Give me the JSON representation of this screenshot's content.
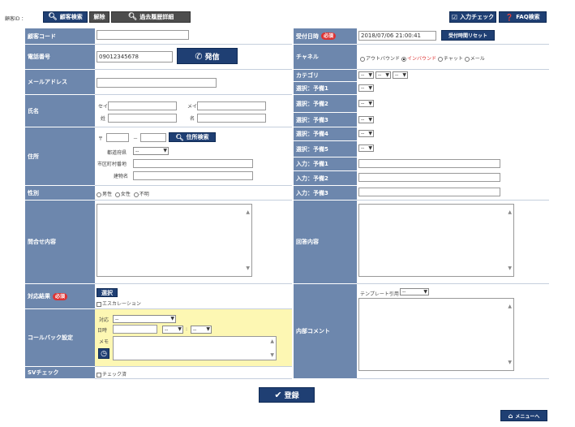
{
  "toolbar": {
    "customer_id_label": "顧客ID ：",
    "customer_search": "顧客検索",
    "clear": "解除",
    "past_history": "過去履歴詳細",
    "input_check": "入力チェック",
    "faq_search": "FAQ検索"
  },
  "left": {
    "customer_code_label": "顧客コード",
    "customer_code_value": "",
    "phone_label": "電話番号",
    "phone_value": "09012345678",
    "call_button": "発信",
    "email_label": "メールアドレス",
    "email_value": "",
    "name_label": "氏名",
    "sei_kana": "セイ",
    "mei_kana": "メイ",
    "sei": "姓",
    "mei": "名",
    "address_label": "住所",
    "postal_mark": "〒",
    "postal_dash": "－",
    "address_search": "住所検索",
    "prefecture_label": "都道府県",
    "prefecture_value": "--",
    "city_label": "市区町村番地",
    "building_label": "建物名",
    "gender_label": "性別",
    "gender_options": [
      "男性",
      "女性",
      "不明"
    ],
    "inquiry_label": "問合せ内容",
    "result_label": "対応結果",
    "required_badge": "必須",
    "select_button": "選択",
    "escalation": "エスカレーション",
    "callback_label": "コールバック設定",
    "callback_handler_label": "対応",
    "callback_handler_value": "--",
    "callback_date_label": "日時",
    "callback_hour": "--",
    "callback_colon": ":",
    "callback_min": "--",
    "callback_memo_label": "メモ",
    "sv_label": "SVチェック",
    "sv_check": "チェック済"
  },
  "right": {
    "received_label": "受付日時",
    "received_value": "2018/07/06 21:00:41",
    "reset_time_button": "受付時間リセット",
    "channel_label": "チャネル",
    "channels": [
      "アウトバウンド",
      "インバウンド",
      "チャット",
      "メール"
    ],
    "channel_selected": 1,
    "category_label": "カテゴリ",
    "category_value": "--",
    "select1_label": "選択：予備1",
    "select2_label": "選択：予備2",
    "select3_label": "選択：予備3",
    "select4_label": "選択：予備4",
    "select5_label": "選択：予備5",
    "input1_label": "入力：予備1",
    "input2_label": "入力：予備2",
    "input3_label": "入力：予備3",
    "select_placeholder": "--",
    "answer_label": "回答内容",
    "comment_label": "内部コメント",
    "template_label": "テンプレート引用",
    "template_value": "--"
  },
  "footer": {
    "register_button": "登録",
    "menu_button": "メニューへ"
  },
  "colors": {
    "label_bg": "#6d87ad",
    "navy": "#1f3f73",
    "callback_bg": "#fdf7b3",
    "required": "#d33333"
  }
}
